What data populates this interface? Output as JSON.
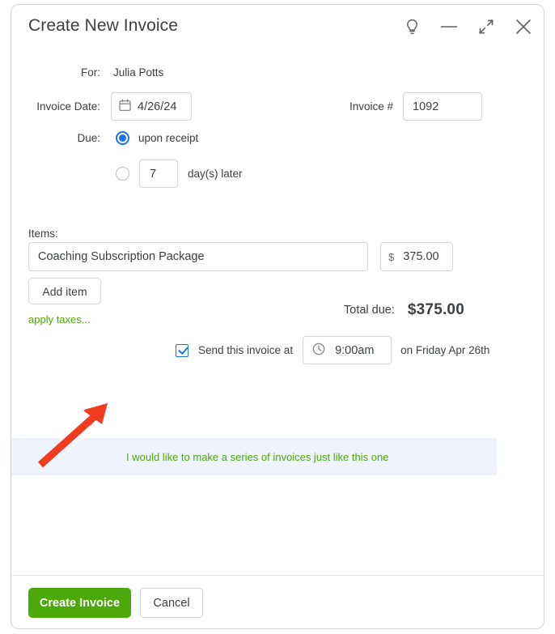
{
  "window": {
    "title": "Create New Invoice",
    "controls": [
      {
        "name": "lightbulb-icon",
        "label": "Tips"
      },
      {
        "name": "minimize-icon",
        "label": "Minimize"
      },
      {
        "name": "collapse-icon",
        "label": "Collapse"
      },
      {
        "name": "close-icon",
        "label": "Close"
      }
    ]
  },
  "form": {
    "for_label": "For:",
    "for_value": "Julia Potts",
    "invoice_date_label": "Invoice Date:",
    "invoice_date_value": "4/26/24",
    "invoice_number_label": "Invoice #",
    "invoice_number_value": "1092",
    "due_label": "Due:",
    "due_option_receipt": "upon receipt",
    "due_days_value": "7",
    "due_option_days_suffix": "day(s) later",
    "due_selected": "upon receipt"
  },
  "items": {
    "label": "Items:",
    "rows": [
      {
        "description": "Coaching Subscription Package",
        "currency": "$",
        "amount": "375.00"
      }
    ],
    "add_item_label": "Add item",
    "apply_taxes_label": "apply taxes..."
  },
  "totals": {
    "total_due_label": "Total due:",
    "total_due_value": "$375.00"
  },
  "schedule": {
    "checkbox_checked": true,
    "send_prefix": "Send this invoice at",
    "time_value": "9:00am",
    "send_suffix": "on Friday Apr 26th"
  },
  "banner": {
    "link_label": "I would like to make a series of invoices just like this one",
    "background": "#eef3fc",
    "link_color": "#4ca80b"
  },
  "annotation": {
    "arrow_color": "#f03b1e"
  },
  "footer": {
    "primary_label": "Create Invoice",
    "primary_color": "#4ca80b",
    "cancel_label": "Cancel"
  }
}
